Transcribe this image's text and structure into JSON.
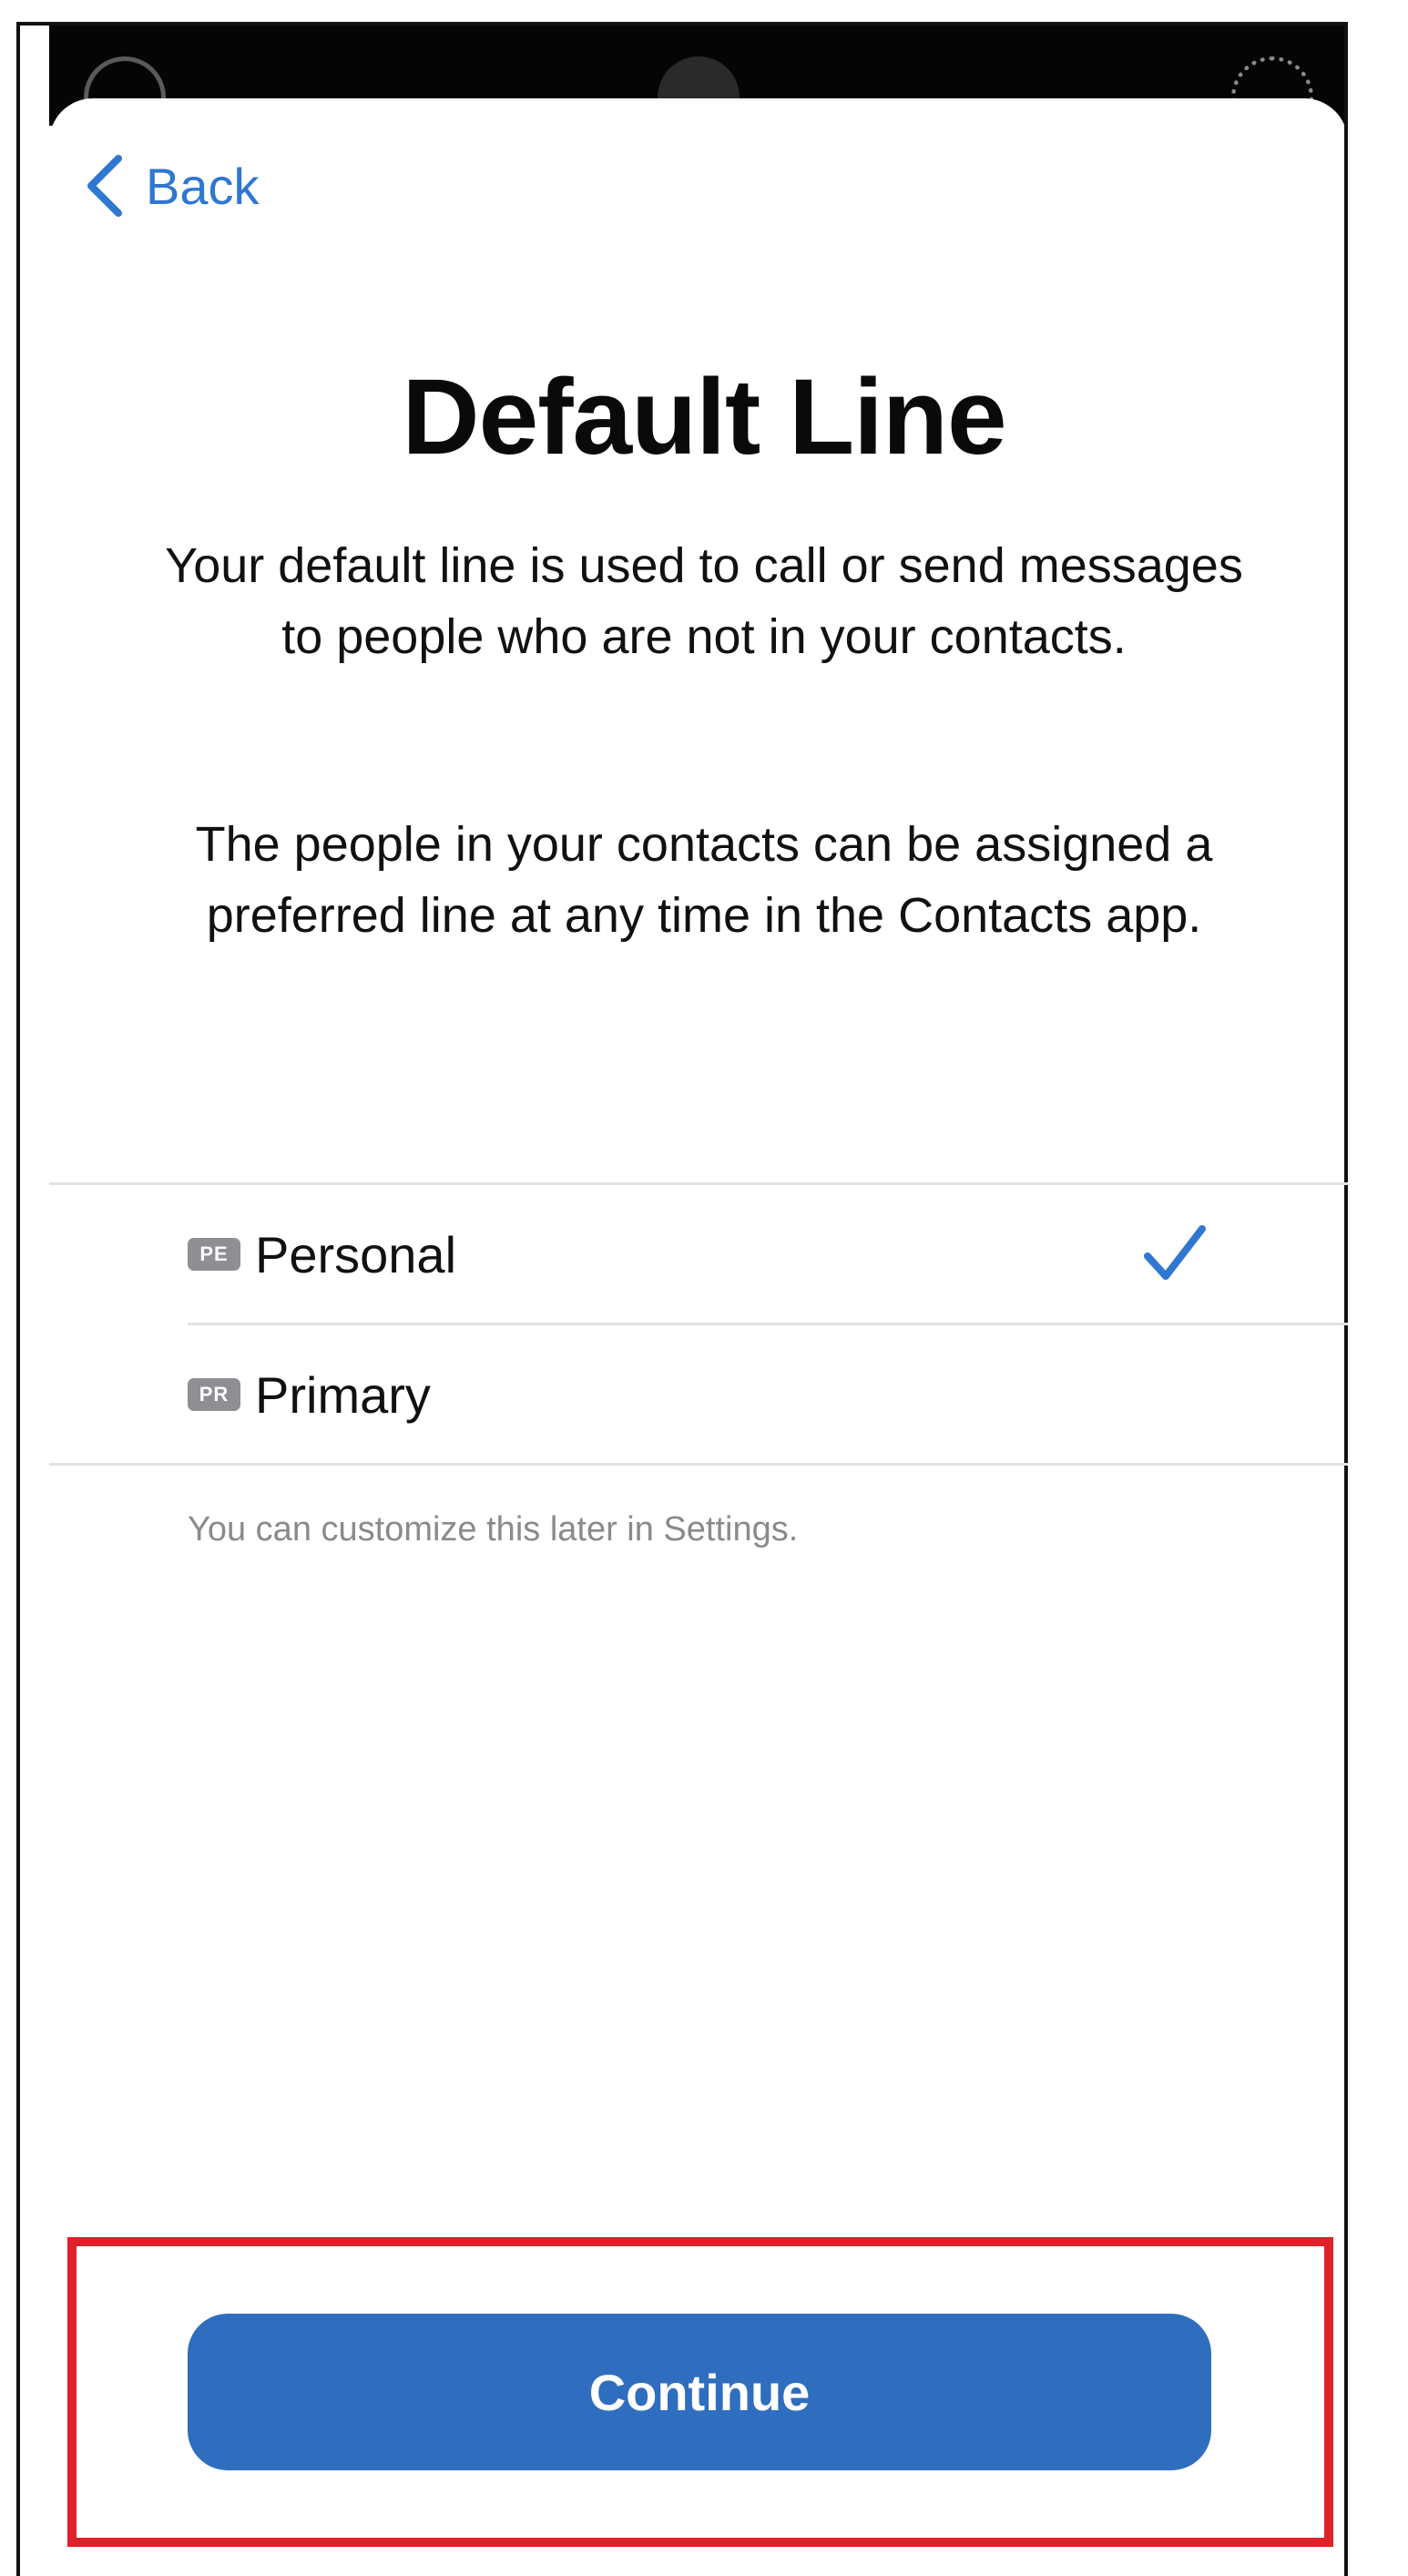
{
  "nav": {
    "back_label": "Back"
  },
  "header": {
    "title": "Default Line"
  },
  "main": {
    "description_1": "Your default line is used to call or send messages to people who are not in your contacts.",
    "description_2": "The people in your contacts can be assigned a preferred line at any time in the Contacts app.",
    "lines": [
      {
        "badge": "PE",
        "label": "Personal",
        "selected": true
      },
      {
        "badge": "PR",
        "label": "Primary",
        "selected": false
      }
    ],
    "footnote": "You can customize this later in Settings."
  },
  "footer": {
    "continue_label": "Continue"
  },
  "icons": {
    "back": "chevron-left-icon",
    "selected": "checkmark-icon"
  },
  "colors": {
    "accent": "#2f77d0",
    "button": "#2f6ebf",
    "badge": "#8e8e93",
    "highlight": "#e0202a"
  }
}
